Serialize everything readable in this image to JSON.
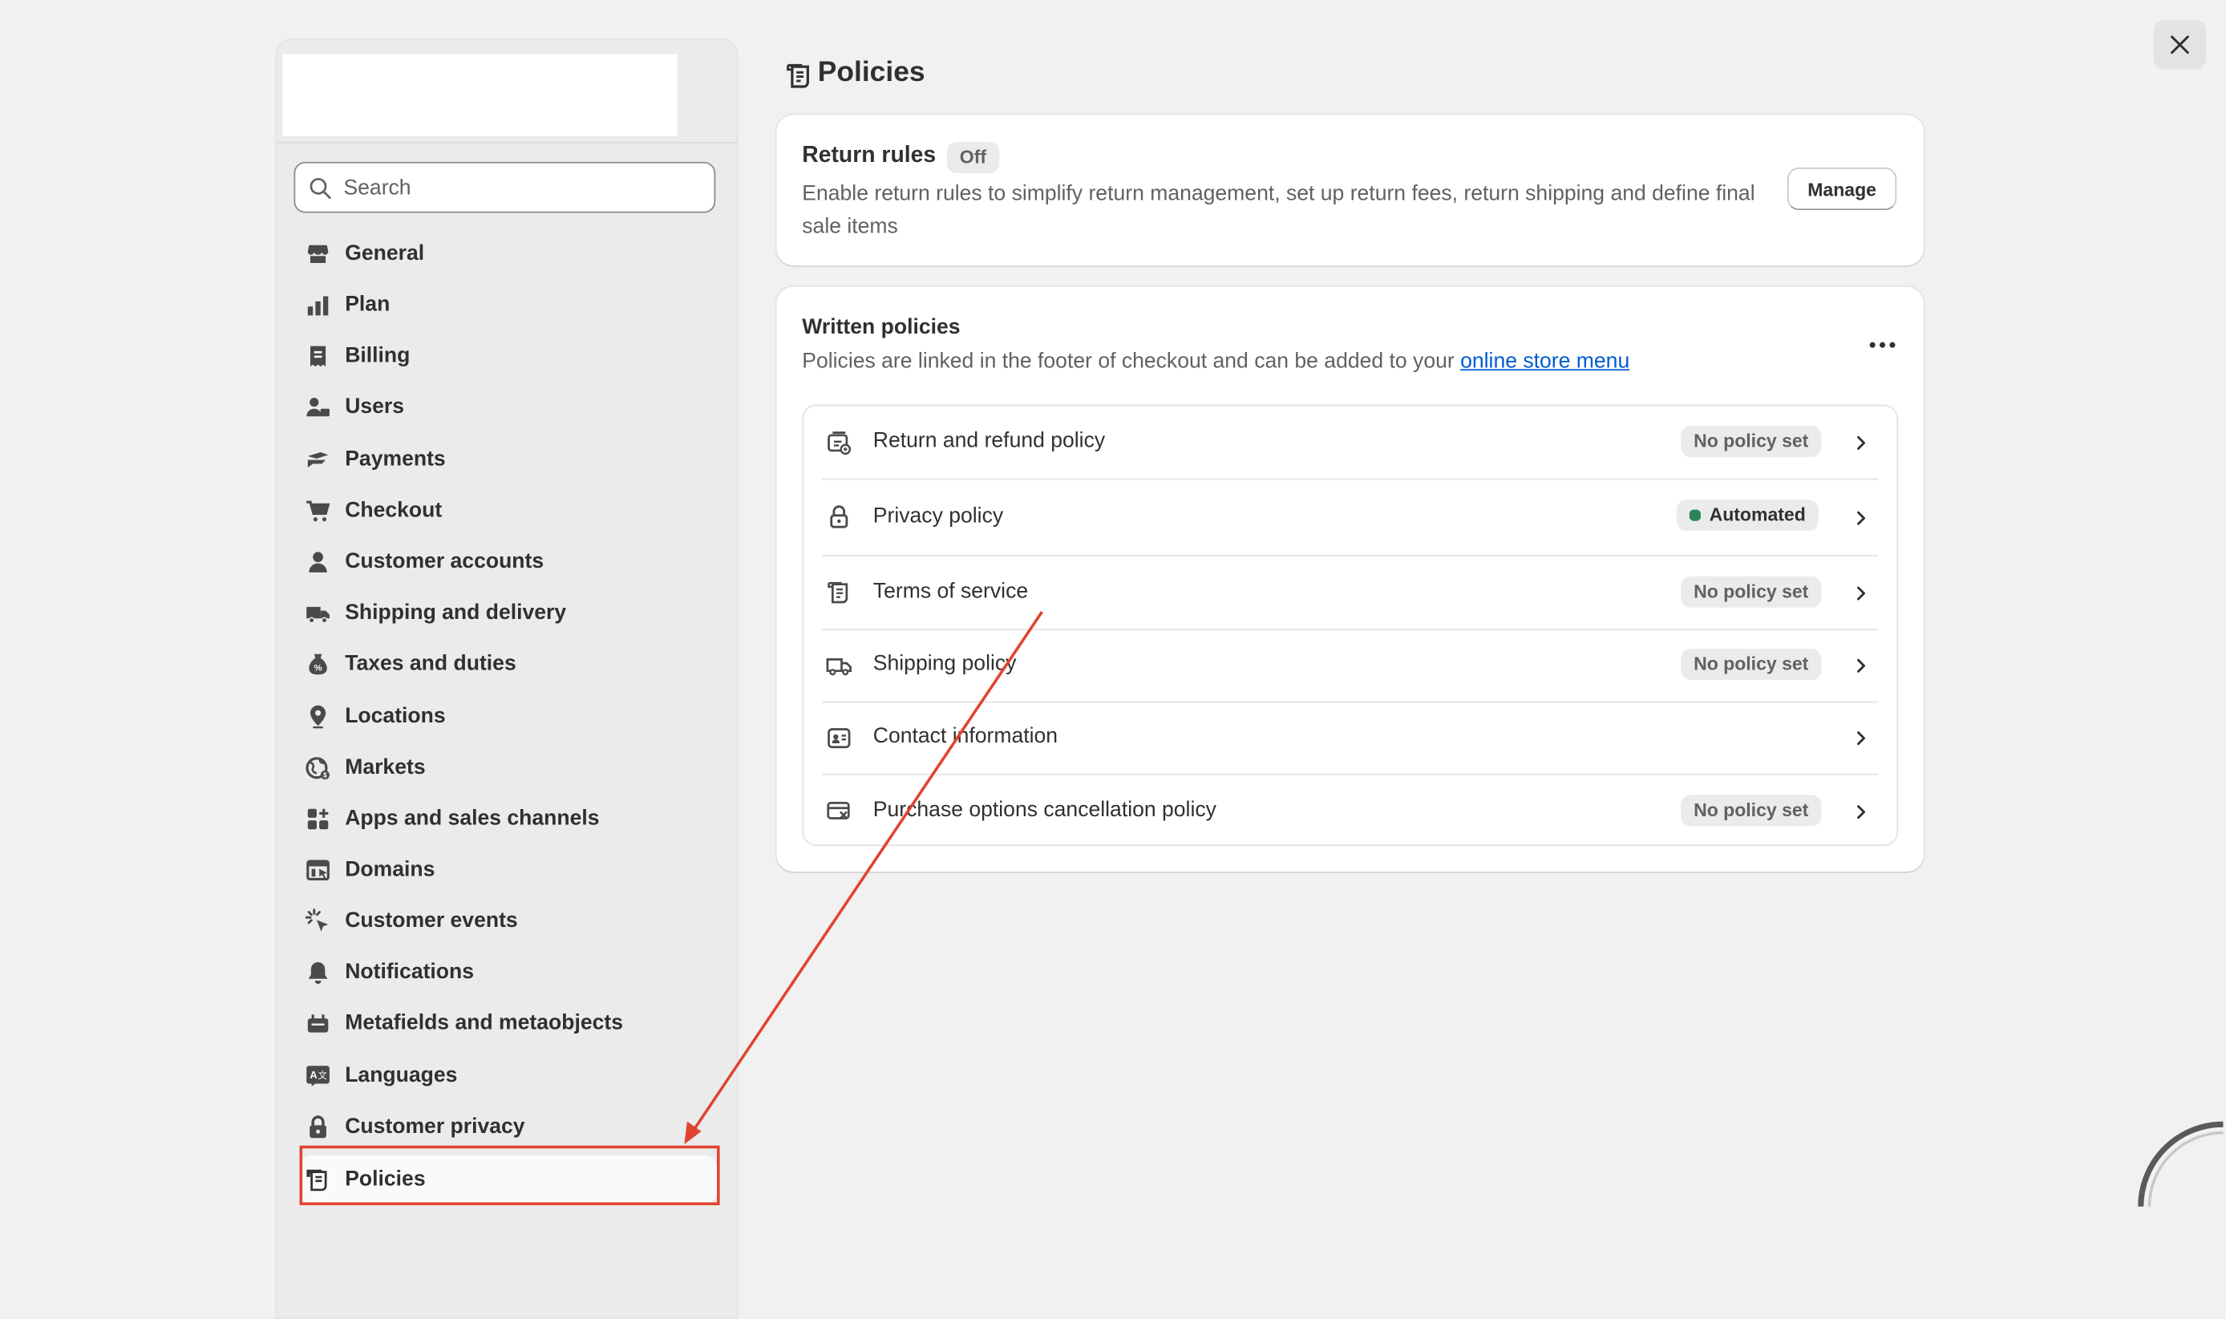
{
  "sidebar": {
    "search_placeholder": "Search",
    "items": [
      {
        "label": "General",
        "icon": "store-icon"
      },
      {
        "label": "Plan",
        "icon": "plan-icon"
      },
      {
        "label": "Billing",
        "icon": "billing-icon"
      },
      {
        "label": "Users",
        "icon": "users-icon"
      },
      {
        "label": "Payments",
        "icon": "payments-icon"
      },
      {
        "label": "Checkout",
        "icon": "cart-icon"
      },
      {
        "label": "Customer accounts",
        "icon": "person-icon"
      },
      {
        "label": "Shipping and delivery",
        "icon": "truck-icon"
      },
      {
        "label": "Taxes and duties",
        "icon": "tax-icon"
      },
      {
        "label": "Locations",
        "icon": "location-pin-icon"
      },
      {
        "label": "Markets",
        "icon": "globe-icon"
      },
      {
        "label": "Apps and sales channels",
        "icon": "apps-icon"
      },
      {
        "label": "Domains",
        "icon": "domains-icon"
      },
      {
        "label": "Customer events",
        "icon": "cursor-click-icon"
      },
      {
        "label": "Notifications",
        "icon": "bell-icon"
      },
      {
        "label": "Metafields and metaobjects",
        "icon": "metafields-icon"
      },
      {
        "label": "Languages",
        "icon": "language-icon"
      },
      {
        "label": "Customer privacy",
        "icon": "lock-icon"
      },
      {
        "label": "Policies",
        "icon": "policy-icon",
        "active": true
      }
    ]
  },
  "page": {
    "title": "Policies",
    "icon": "policy-icon"
  },
  "return_rules": {
    "title": "Return rules",
    "badge": "Off",
    "description": "Enable return rules to simplify return management, set up return fees, return shipping and define final sale items",
    "button": "Manage"
  },
  "written_policies": {
    "title": "Written policies",
    "desc_prefix": "Policies are linked in the footer of checkout and can be added to your ",
    "desc_link": "online store menu",
    "policies": [
      {
        "label": "Return and refund policy",
        "status": "No policy set",
        "icon": "return-icon"
      },
      {
        "label": "Privacy policy",
        "status": "Automated",
        "icon": "lock-icon"
      },
      {
        "label": "Terms of service",
        "status": "No policy set",
        "icon": "policy-icon"
      },
      {
        "label": "Shipping policy",
        "status": "No policy set",
        "icon": "truck-icon"
      },
      {
        "label": "Contact information",
        "status": "",
        "icon": "contact-card-icon"
      },
      {
        "label": "Purchase options cancellation policy",
        "status": "No policy set",
        "icon": "card-cancel-icon"
      }
    ]
  },
  "colors": {
    "accent_link": "#005bd3",
    "automated_dot": "#29845a",
    "annotation": "#e0432f"
  }
}
